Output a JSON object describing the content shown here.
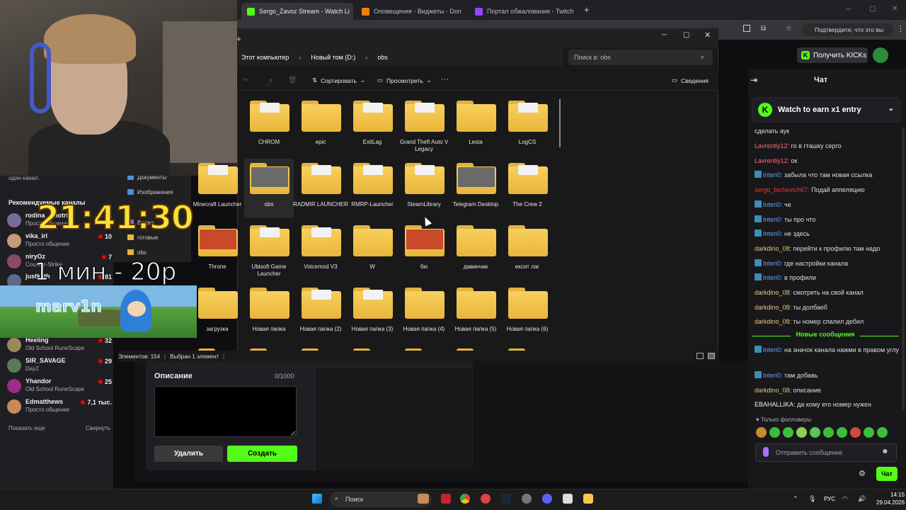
{
  "browser": {
    "tabs": [
      {
        "label": "Sergo_Zavoz Stream - Watch Li",
        "color": "#53fc18"
      },
      {
        "label": "Оповещения - Виджеты - Don",
        "color": "#f57d07"
      },
      {
        "label": "Портал обжалования - Twitch",
        "color": "#9146ff"
      }
    ],
    "new_tab": "+",
    "confirm_label": "Подтвердите, что это вы"
  },
  "kick": {
    "kicks_button": "Получить KICKs",
    "chat_title": "Чат",
    "earn_label": "Watch to earn x1 entry",
    "new_messages": "Новые сообщения",
    "followers_only": "Только фолловеры",
    "input_placeholder": "Отправить сообщение",
    "send_label": "Чат",
    "messages": [
      {
        "user": "",
        "color": "#dedee3",
        "text": "сделать аук",
        "badge": false
      },
      {
        "user": "Lavrentiy12",
        "color": "#ff6b6b",
        "text": "го в гташку серго",
        "badge": false
      },
      {
        "user": "Lavrentiy12",
        "color": "#ff6b6b",
        "text": "ок",
        "badge": false
      },
      {
        "user": "Interi0",
        "color": "#5aa7ff",
        "text": "забыла что там новая ссылка",
        "badge": true
      },
      {
        "user": "sergo_bichevich67",
        "color": "#e23b3b",
        "text": "Подай аппеляцию",
        "badge": false
      },
      {
        "user": "Interi0",
        "color": "#5aa7ff",
        "text": "че",
        "badge": true
      },
      {
        "user": "Interi0",
        "color": "#5aa7ff",
        "text": "ты про что",
        "badge": true
      },
      {
        "user": "Interi0",
        "color": "#5aa7ff",
        "text": "не здесь",
        "badge": true
      },
      {
        "user": "darkdino_08",
        "color": "#e6c88a",
        "text": "перейти к профилю там надо",
        "badge": false
      },
      {
        "user": "Interi0",
        "color": "#5aa7ff",
        "text": "где настройки канала",
        "badge": true
      },
      {
        "user": "Interi0",
        "color": "#5aa7ff",
        "text": "в профили",
        "badge": true
      },
      {
        "user": "darkdino_08",
        "color": "#e6c88a",
        "text": "смотреть на свой канал",
        "badge": false
      },
      {
        "user": "darkdino_08",
        "color": "#e6c88a",
        "text": "ты долбаеб",
        "badge": false
      },
      {
        "user": "darkdino_08",
        "color": "#e6c88a",
        "text": "ты номер спалил дебил",
        "badge": false
      },
      {
        "user": "Interi0",
        "color": "#5aa7ff",
        "text": "на значок канала нажми в правом углу",
        "badge": true
      },
      {
        "user": "Interi0",
        "color": "#5aa7ff",
        "text": "там добавь",
        "badge": true
      },
      {
        "user": "darkdino_08",
        "color": "#e6c88a",
        "text": "описание",
        "badge": false
      },
      {
        "user": "EBAHALLIKA",
        "color": "#efeff1",
        "text": "да кому его номер нужен",
        "badge": false
      }
    ]
  },
  "sidebar": {
    "one_channel": "один канал.",
    "recommended_title": "Рекомендуемые каналы",
    "channels": [
      {
        "name": "rodina_smotri",
        "game": "Просто общение",
        "viewers": "14",
        "color": "#7a6a9a"
      },
      {
        "name": "vika_irl",
        "game": "Просто общение",
        "viewers": "10",
        "color": "#c79a7a"
      },
      {
        "name": "niryOz",
        "game": "Counter-Strike",
        "viewers": "7",
        "color": "#8a4a6a"
      },
      {
        "name": "justketh",
        "game": "",
        "viewers": "81",
        "color": "#5a6a8a"
      },
      {
        "name": "Heeling",
        "game": "Old School RuneScape",
        "viewers": "32",
        "color": "#9a8a5a"
      },
      {
        "name": "SIR_SAVAGE",
        "game": "DayZ",
        "viewers": "29",
        "color": "#5a7a5a"
      },
      {
        "name": "Yhandor",
        "game": "Old School RuneScape",
        "viewers": "25",
        "color": "#9b2c8a"
      },
      {
        "name": "Edmatthews",
        "game": "Просто общение",
        "viewers": "7,1 тыс.",
        "color": "#c88a5a"
      }
    ],
    "show_more": "Показать еще",
    "collapse": "Свернуть"
  },
  "overlay": {
    "clock": "21:41:30",
    "price": "1 мин - 20р",
    "marv": "marv1n"
  },
  "explorer": {
    "path": [
      "Этот компьютер",
      "Новый том (D:)",
      "obs"
    ],
    "search_placeholder": "Поиск в: obs",
    "toolbar": {
      "sort": "Сортировать",
      "view": "Просмотреть",
      "more": "···",
      "details": "Сведения"
    },
    "nav": [
      {
        "label": "Документы"
      },
      {
        "label": "Изображения"
      },
      {
        "label": "Видео"
      },
      {
        "label": "obs"
      },
      {
        "label": "готовые"
      }
    ],
    "items": [
      {
        "label": "CHROM",
        "content": "paper"
      },
      {
        "label": "epic",
        "content": "none"
      },
      {
        "label": "ExitLag",
        "content": "paper"
      },
      {
        "label": "Grand Theft Auto V Legacy",
        "content": "paper"
      },
      {
        "label": "Lesta",
        "content": "none"
      },
      {
        "label": "LogCS",
        "content": "paper"
      },
      {
        "label": "Minecraft Launcher",
        "content": "paper"
      },
      {
        "label": "obs",
        "content": "thumb",
        "selected": true
      },
      {
        "label": "RADMIR LAUNCHER",
        "content": "paper"
      },
      {
        "label": "RMRP-Launcher",
        "content": "paper"
      },
      {
        "label": "SteamLibrary",
        "content": "paper"
      },
      {
        "label": "Telegram Desktop",
        "content": "thumb"
      },
      {
        "label": "The Crew 2",
        "content": "paper"
      },
      {
        "label": "Throne",
        "content": "thumb"
      },
      {
        "label": "Ubisoft Game Launcher",
        "content": "paper"
      },
      {
        "label": "Voicemod V3",
        "content": "paper"
      },
      {
        "label": "W",
        "content": "none"
      },
      {
        "label": "бю",
        "content": "thumb"
      },
      {
        "label": "давинчик",
        "content": "none"
      },
      {
        "label": "ексит лаг",
        "content": "none"
      },
      {
        "label": "загрузка",
        "content": "none"
      },
      {
        "label": "Новая папка",
        "content": "none"
      },
      {
        "label": "Новая папка (2)",
        "content": "paper"
      },
      {
        "label": "Новая папка (3)",
        "content": "paper"
      },
      {
        "label": "Новая папка (4)",
        "content": "none"
      },
      {
        "label": "Новая папка (5)",
        "content": "none"
      },
      {
        "label": "Новая папка (6)",
        "content": "none"
      }
    ],
    "status_count": "Элементов: 154",
    "status_selected": "Выбран 1 элемент"
  },
  "form": {
    "description_label": "Описание",
    "description_count": "0/1000",
    "delete_label": "Удалить",
    "create_label": "Создать"
  },
  "taskbar": {
    "search": "Поиск",
    "lang": "РУС",
    "time": "14:15",
    "date": "29.04.2026"
  },
  "colors": {
    "accent": "#53fc18",
    "folder": "#f4c84e"
  }
}
